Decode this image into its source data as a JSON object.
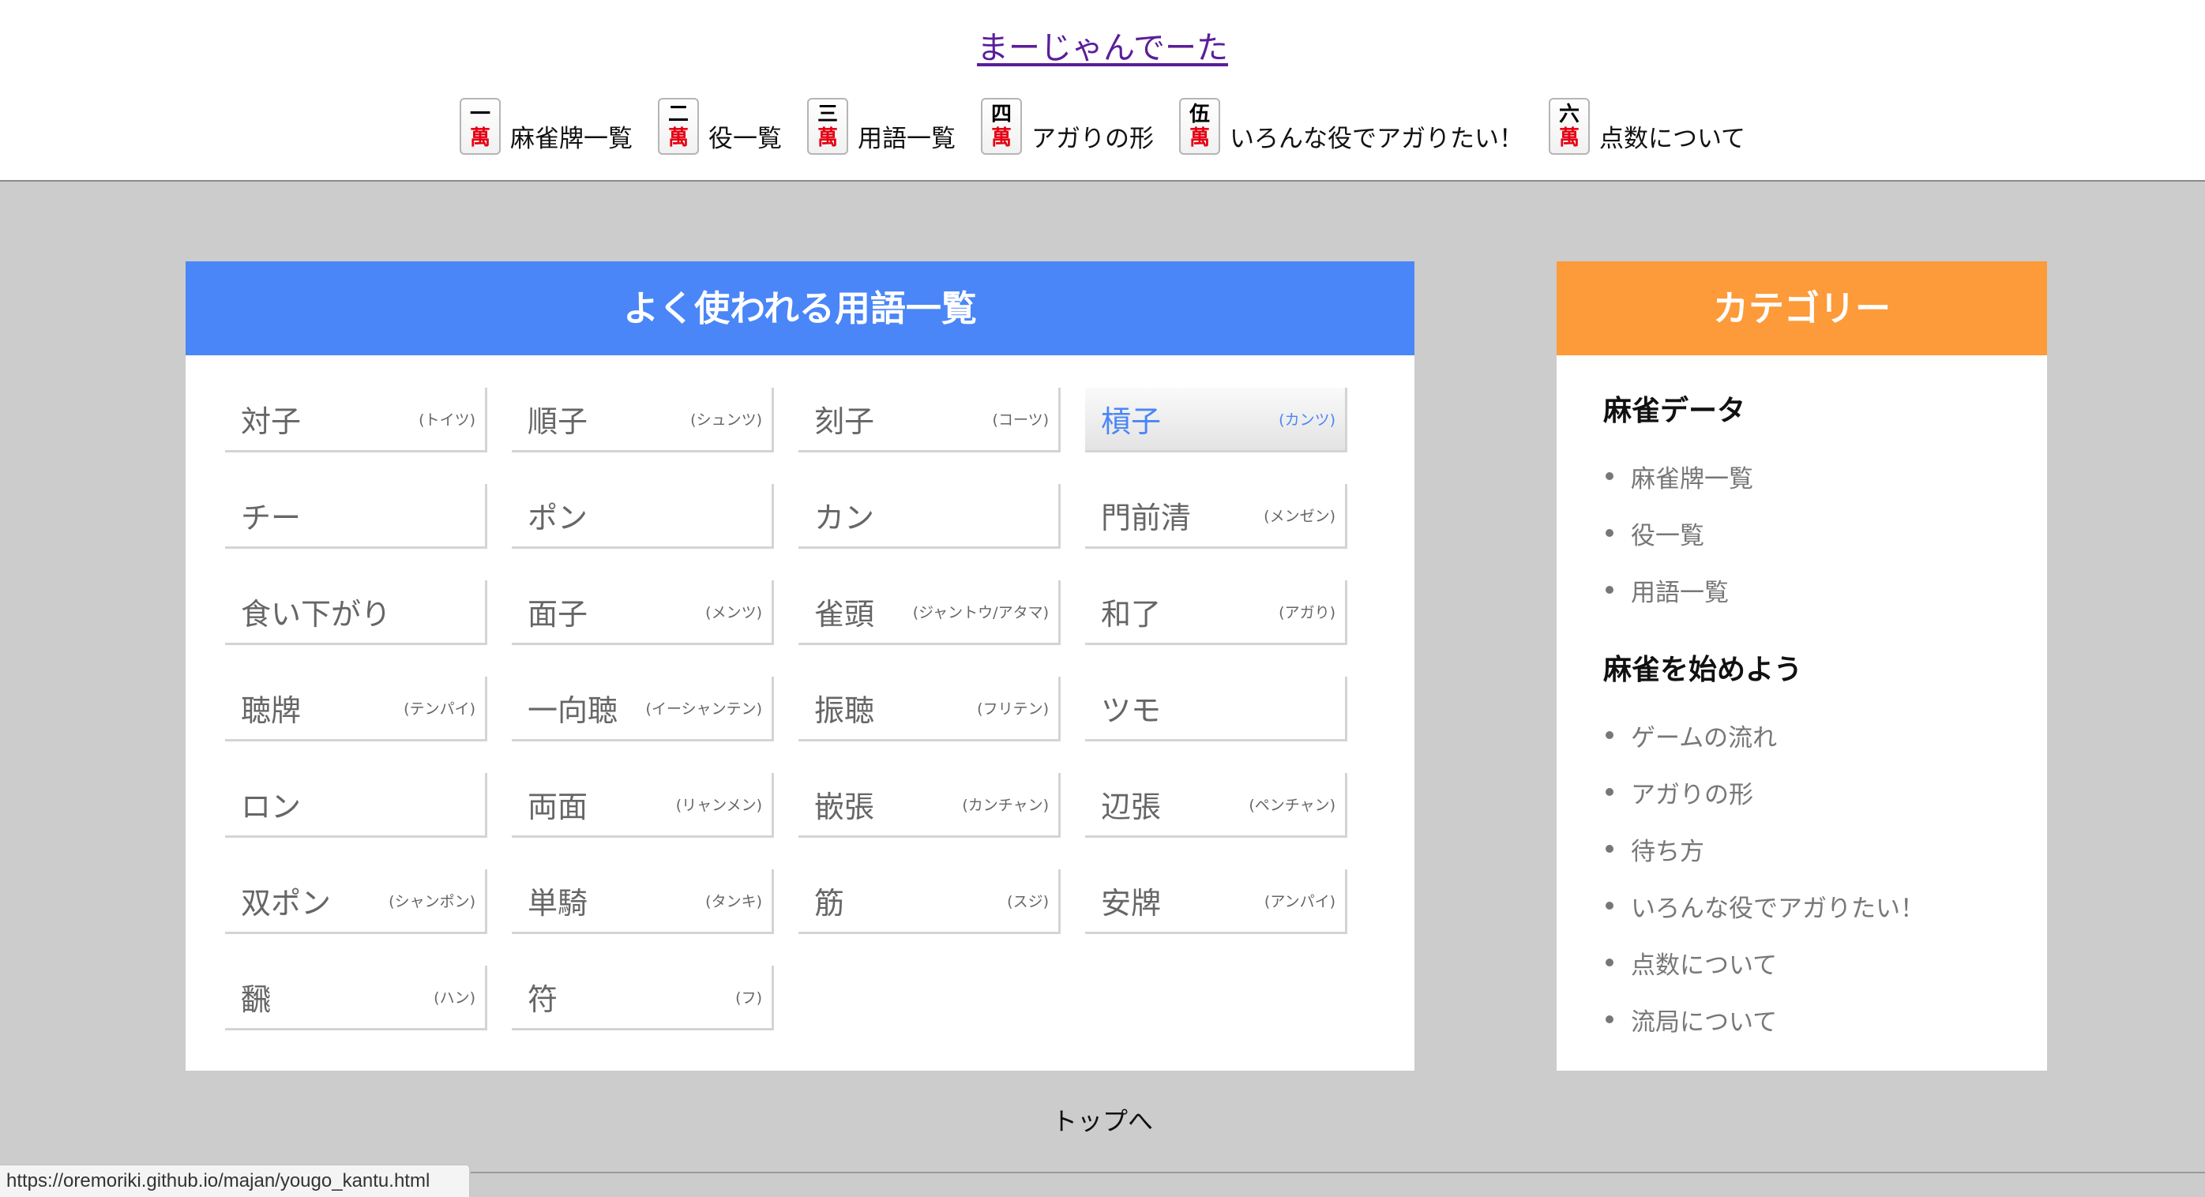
{
  "site": {
    "title": "まーじゃんでーた"
  },
  "nav": [
    {
      "tile_num": "一",
      "tile_man": "萬",
      "label": "麻雀牌一覧"
    },
    {
      "tile_num": "二",
      "tile_man": "萬",
      "label": "役一覧"
    },
    {
      "tile_num": "三",
      "tile_man": "萬",
      "label": "用語一覧"
    },
    {
      "tile_num": "四",
      "tile_man": "萬",
      "label": "アガりの形"
    },
    {
      "tile_num": "伍",
      "tile_man": "萬",
      "label": "いろんな役でアガりたい！"
    },
    {
      "tile_num": "六",
      "tile_man": "萬",
      "label": "点数について"
    }
  ],
  "main": {
    "heading": "よく使われる用語一覧",
    "terms": [
      {
        "name": "対子",
        "reading": "(トイツ)"
      },
      {
        "name": "順子",
        "reading": "(シュンツ)"
      },
      {
        "name": "刻子",
        "reading": "(コーツ)"
      },
      {
        "name": "槓子",
        "reading": "(カンツ)"
      },
      {
        "name": "チー",
        "reading": ""
      },
      {
        "name": "ポン",
        "reading": ""
      },
      {
        "name": "カン",
        "reading": ""
      },
      {
        "name": "門前清",
        "reading": "(メンゼン)"
      },
      {
        "name": "食い下がり",
        "reading": ""
      },
      {
        "name": "面子",
        "reading": "(メンツ)"
      },
      {
        "name": "雀頭",
        "reading": "(ジャントウ/アタマ)"
      },
      {
        "name": "和了",
        "reading": "(アガり)"
      },
      {
        "name": "聴牌",
        "reading": "(テンパイ)"
      },
      {
        "name": "一向聴",
        "reading": "(イーシャンテン)"
      },
      {
        "name": "振聴",
        "reading": "(フリテン)"
      },
      {
        "name": "ツモ",
        "reading": ""
      },
      {
        "name": "ロン",
        "reading": ""
      },
      {
        "name": "両面",
        "reading": "(リャンメン)"
      },
      {
        "name": "嵌張",
        "reading": "(カンチャン)"
      },
      {
        "name": "辺張",
        "reading": "(ペンチャン)"
      },
      {
        "name": "双ポン",
        "reading": "(シャンポン)"
      },
      {
        "name": "単騎",
        "reading": "(タンキ)"
      },
      {
        "name": "筋",
        "reading": "(スジ)"
      },
      {
        "name": "安牌",
        "reading": "(アンパイ)"
      },
      {
        "name": "飜",
        "reading": "(ハン)"
      },
      {
        "name": "符",
        "reading": "(フ)"
      }
    ]
  },
  "sidebar": {
    "heading": "カテゴリー",
    "sections": [
      {
        "title": "麻雀データ",
        "items": [
          "麻雀牌一覧",
          "役一覧",
          "用語一覧"
        ]
      },
      {
        "title": "麻雀を始めよう",
        "items": [
          "ゲームの流れ",
          "アガりの形",
          "待ち方",
          "いろんな役でアガりたい！",
          "点数について",
          "流局について"
        ]
      }
    ]
  },
  "footer": {
    "top_link": "トップへ"
  },
  "status_bar": {
    "url": "https://oremoriki.github.io/majan/yougo_kantu.html"
  },
  "colors": {
    "main_header": "#4a86f7",
    "side_header": "#fd9a3a",
    "tile_red": "#e60012"
  }
}
